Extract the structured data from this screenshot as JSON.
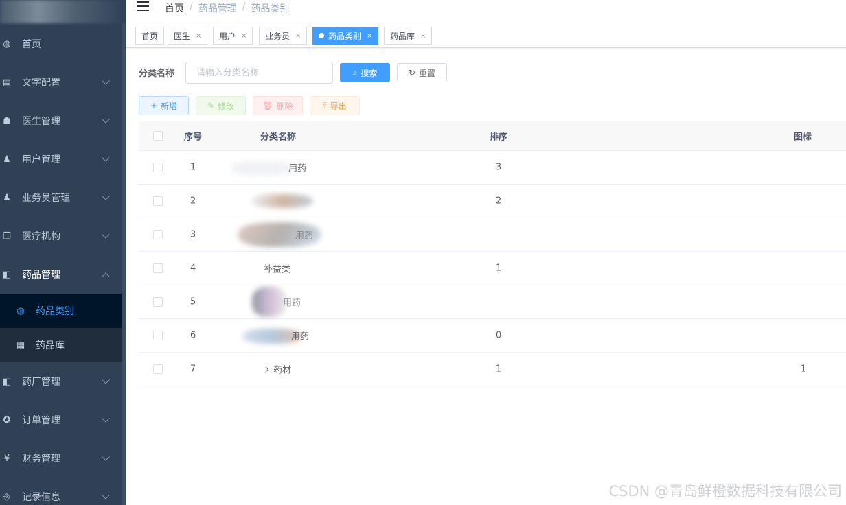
{
  "sidebar": {
    "items": [
      {
        "label": "首页",
        "icon": "dashboard-icon"
      },
      {
        "label": "文字配置",
        "icon": "document-icon"
      },
      {
        "label": "医生管理",
        "icon": "doctor-icon"
      },
      {
        "label": "用户管理",
        "icon": "user-icon"
      },
      {
        "label": "业务员管理",
        "icon": "user-icon"
      },
      {
        "label": "医疗机构",
        "icon": "copy-icon"
      },
      {
        "label": "药品管理",
        "icon": "book-icon"
      },
      {
        "label": "药厂管理",
        "icon": "book-icon"
      },
      {
        "label": "订单管理",
        "icon": "lifebuoy-icon"
      },
      {
        "label": "财务管理",
        "icon": "yen-icon"
      },
      {
        "label": "记录信息",
        "icon": "log-icon"
      }
    ],
    "submenu": [
      {
        "label": "药品类别",
        "icon": "dashboard-icon"
      },
      {
        "label": "药品库",
        "icon": "clapper-icon"
      }
    ]
  },
  "breadcrumb": [
    "首页",
    "药品管理",
    "药品类别"
  ],
  "tags": [
    {
      "label": "首页"
    },
    {
      "label": "医生"
    },
    {
      "label": "用户"
    },
    {
      "label": "业务员"
    },
    {
      "label": "药品类别"
    },
    {
      "label": "药品库"
    }
  ],
  "search": {
    "label": "分类名称",
    "placeholder": "请输入分类名称",
    "search_btn": "搜索",
    "reset_btn": "重置"
  },
  "toolbar": {
    "add": "新增",
    "edit": "修改",
    "delete": "删除",
    "export": "导出"
  },
  "table": {
    "headers": {
      "index": "序号",
      "name": "分类名称",
      "sort": "排序",
      "icon": "图标"
    },
    "rows": [
      {
        "index": "1",
        "name": "用药",
        "sort": "3",
        "icon": ""
      },
      {
        "index": "2",
        "name": "",
        "sort": "2",
        "icon": ""
      },
      {
        "index": "3",
        "name": "用药",
        "sort": "",
        "icon": ""
      },
      {
        "index": "4",
        "name": "补益类",
        "sort": "1",
        "icon": ""
      },
      {
        "index": "5",
        "name": "用药",
        "sort": "",
        "icon": ""
      },
      {
        "index": "6",
        "name": "用药",
        "sort": "0",
        "icon": ""
      },
      {
        "index": "7",
        "name": "药材",
        "sort": "1",
        "icon": "1"
      }
    ]
  },
  "watermark": "CSDN @青岛鲜橙数据科技有限公司",
  "colors": {
    "sidebar_bg": "#304156",
    "primary": "#409eff",
    "active_sub_bg": "#001528"
  }
}
